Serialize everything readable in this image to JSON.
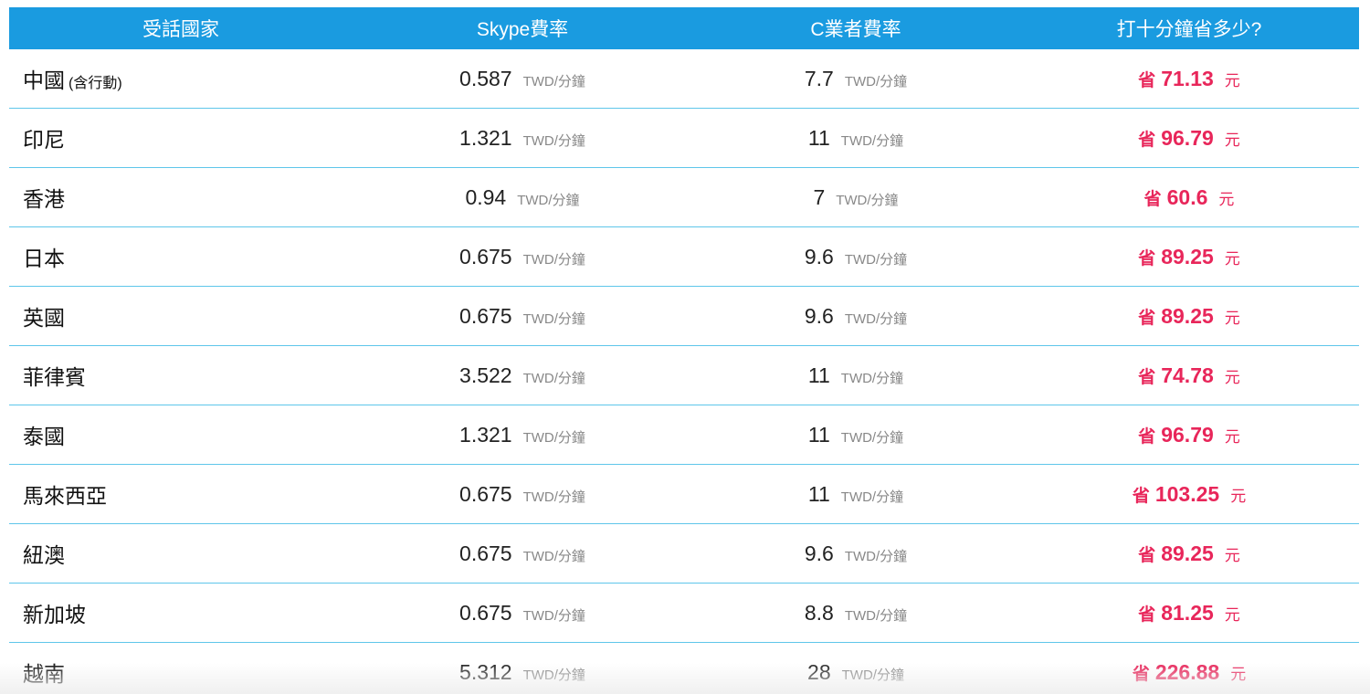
{
  "header": {
    "country": "受話國家",
    "skype_rate": "Skype費率",
    "carrier_rate": "C業者費率",
    "savings": "打十分鐘省多少?"
  },
  "unit": "TWD/分鐘",
  "save_prefix": "省",
  "save_suffix": "元",
  "rows": [
    {
      "country": "中國",
      "note": "(含行動)",
      "skype": "0.587",
      "carrier": "7.7",
      "saving": "71.13"
    },
    {
      "country": "印尼",
      "note": "",
      "skype": "1.321",
      "carrier": "11",
      "saving": "96.79"
    },
    {
      "country": "香港",
      "note": "",
      "skype": "0.94",
      "carrier": "7",
      "saving": "60.6"
    },
    {
      "country": "日本",
      "note": "",
      "skype": "0.675",
      "carrier": "9.6",
      "saving": "89.25"
    },
    {
      "country": "英國",
      "note": "",
      "skype": "0.675",
      "carrier": "9.6",
      "saving": "89.25"
    },
    {
      "country": "菲律賓",
      "note": "",
      "skype": "3.522",
      "carrier": "11",
      "saving": "74.78"
    },
    {
      "country": "泰國",
      "note": "",
      "skype": "1.321",
      "carrier": "11",
      "saving": "96.79"
    },
    {
      "country": "馬來西亞",
      "note": "",
      "skype": "0.675",
      "carrier": "11",
      "saving": "103.25"
    },
    {
      "country": "紐澳",
      "note": "",
      "skype": "0.675",
      "carrier": "9.6",
      "saving": "89.25"
    },
    {
      "country": "新加坡",
      "note": "",
      "skype": "0.675",
      "carrier": "8.8",
      "saving": "81.25"
    },
    {
      "country": "越南",
      "note": "",
      "skype": "5.312",
      "carrier": "28",
      "saving": "226.88"
    }
  ],
  "colors": {
    "header_bg": "#1a9be0",
    "row_border": "#5ec6ea",
    "saving_text": "#e8265a"
  }
}
